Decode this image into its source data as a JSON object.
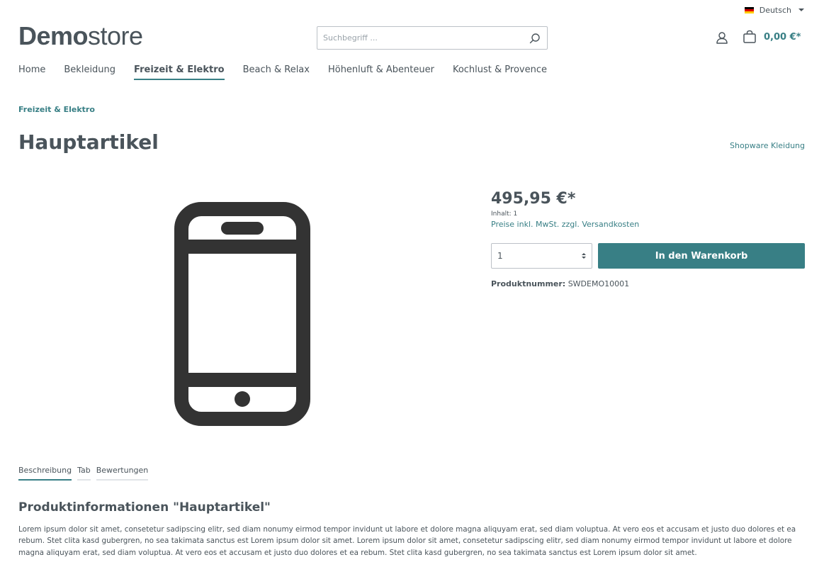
{
  "topbar": {
    "language": "Deutsch",
    "flag_colors": [
      "#000000",
      "#dd0000",
      "#ffcc00"
    ]
  },
  "header": {
    "logo_bold": "Demo",
    "logo_light": "store",
    "search_placeholder": "Suchbegriff ...",
    "search_icon": "search-icon",
    "account_icon": "user-icon",
    "cart_icon": "bag-icon",
    "cart_total": "0,00 €*"
  },
  "nav": {
    "items": [
      {
        "label": "Home"
      },
      {
        "label": "Bekleidung"
      },
      {
        "label": "Freizeit & Elektro",
        "active": true
      },
      {
        "label": "Beach & Relax"
      },
      {
        "label": "Höhenluft & Abenteuer"
      },
      {
        "label": "Kochlust & Provence"
      }
    ]
  },
  "breadcrumb": "Freizeit & Elektro",
  "product": {
    "title": "Hauptartikel",
    "manufacturer": "Shopware Kleidung",
    "image_icon": "smartphone-icon",
    "price": "495,95 €*",
    "content_unit": "Inhalt: 1",
    "tax_link": "Preise inkl. MwSt. zzgl. Versandkosten",
    "quantity": "1",
    "buy_label": "In den Warenkorb",
    "number_label": "Produktnummer:",
    "number_value": "SWDEMO10001"
  },
  "tabs": [
    {
      "label": "Beschreibung",
      "active": true
    },
    {
      "label": "Tab"
    },
    {
      "label": "Bewertungen"
    }
  ],
  "description": {
    "title": "Produktinformationen \"Hauptartikel\"",
    "text": "Lorem ipsum dolor sit amet, consetetur sadipscing elitr, sed diam nonumy eirmod tempor invidunt ut labore et dolore magna aliquyam erat, sed diam voluptua. At vero eos et accusam et justo duo dolores et ea rebum. Stet clita kasd gubergren, no sea takimata sanctus est Lorem ipsum dolor sit amet. Lorem ipsum dolor sit amet, consetetur sadipscing elitr, sed diam nonumy eirmod tempor invidunt ut labore et dolore magna aliquyam erat, sed diam voluptua. At vero eos et accusam et justo duo dolores et ea rebum. Stet clita kasd gubergren, no sea takimata sanctus est Lorem ipsum dolor sit amet."
  },
  "colors": {
    "accent": "#387f85",
    "text": "#4a545b",
    "border": "#bcc1c7"
  }
}
